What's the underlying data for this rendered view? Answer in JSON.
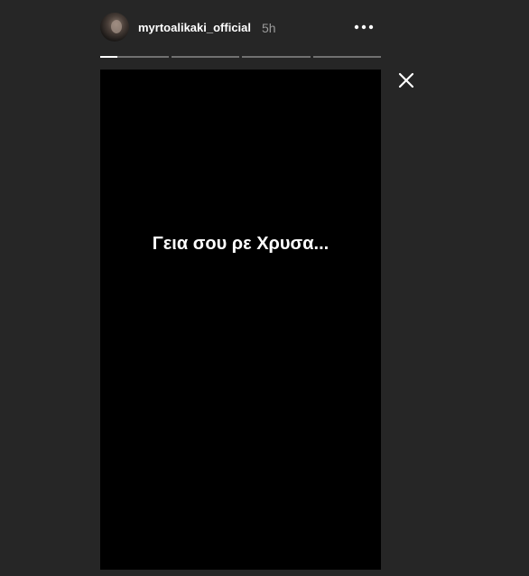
{
  "header": {
    "username": "myrtoalikaki_official",
    "time_ago": "5h",
    "avatar_icon": "user-avatar",
    "more_icon": "more-horizontal-icon"
  },
  "progress": {
    "segments": [
      0.25,
      0,
      0,
      0
    ]
  },
  "close_icon": "close-icon",
  "story": {
    "text": "Γεια σου ρε Χρυσα..."
  },
  "colors": {
    "background": "#262626",
    "story_background": "#000000",
    "text": "#ffffff",
    "secondary_text": "#9a9a9a"
  }
}
